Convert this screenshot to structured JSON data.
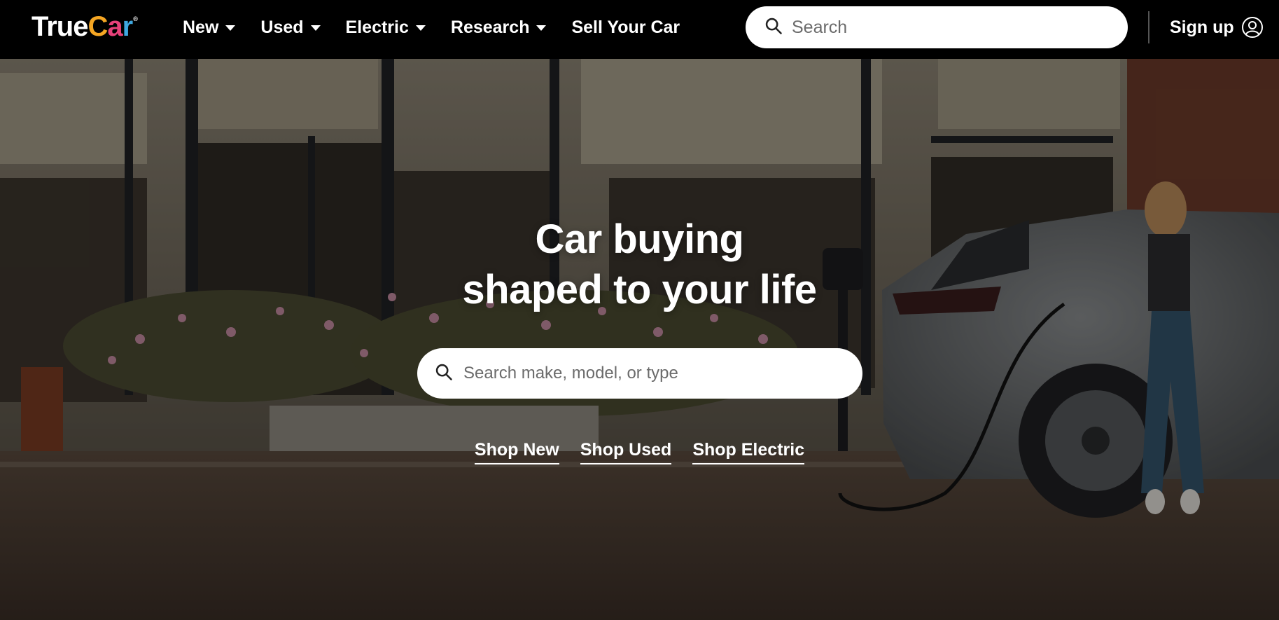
{
  "brand": {
    "logo_true": "True",
    "logo_c": "C",
    "logo_a": "a",
    "logo_r": "r",
    "reg_mark": "®",
    "colors": {
      "c": "#f5a623",
      "a": "#e8417a",
      "r": "#3ea8e0"
    }
  },
  "nav": {
    "items": [
      {
        "label": "New",
        "has_dropdown": true
      },
      {
        "label": "Used",
        "has_dropdown": true
      },
      {
        "label": "Electric",
        "has_dropdown": true
      },
      {
        "label": "Research",
        "has_dropdown": true
      },
      {
        "label": "Sell Your Car",
        "has_dropdown": false
      }
    ],
    "search_placeholder": "Search",
    "signup_label": "Sign up",
    "search_icon": "search-icon",
    "user_icon": "user-circle-icon",
    "caret_icon": "caret-down-icon"
  },
  "hero": {
    "headline_line1": "Car buying",
    "headline_line2": "shaped to your life",
    "search_placeholder": "Search make, model, or type",
    "shop_links": [
      {
        "label": "Shop New"
      },
      {
        "label": "Shop Used"
      },
      {
        "label": "Shop Electric"
      }
    ]
  }
}
